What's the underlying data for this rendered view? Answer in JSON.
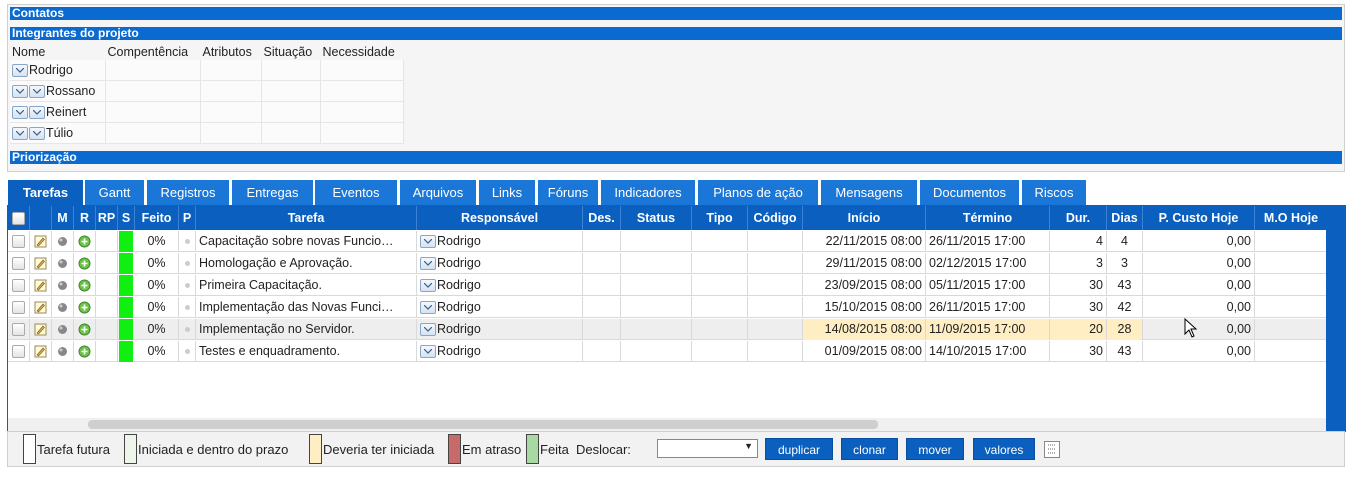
{
  "sections": {
    "contatos": "Contatos",
    "integrantes": "Integrantes do projeto",
    "priorizacao": "Priorização"
  },
  "members": {
    "headers": [
      "Nome",
      "Compentência",
      "Atributos",
      "Situação",
      "Necessidade"
    ],
    "rows": [
      {
        "name": "Rodrigo",
        "arrows": 1
      },
      {
        "name": "Rossano",
        "arrows": 2
      },
      {
        "name": "Reinert",
        "arrows": 2
      },
      {
        "name": "Túlio",
        "arrows": 2
      }
    ]
  },
  "tabs": [
    "Tarefas",
    "Gantt",
    "Registros",
    "Entregas",
    "Eventos",
    "Arquivos",
    "Links",
    "Fóruns",
    "Indicadores",
    "Planos de ação",
    "Mensagens",
    "Documentos",
    "Riscos"
  ],
  "active_tab": "Tarefas",
  "grid": {
    "headers": [
      "",
      "",
      "M",
      "R",
      "RP",
      "S",
      "Feito",
      "P",
      "Tarefa",
      "Responsável",
      "Des.",
      "Status",
      "Tipo",
      "Código",
      "Início",
      "Término",
      "Dur.",
      "Dias",
      "P. Custo Hoje",
      "M.O Hoje"
    ],
    "rows": [
      {
        "feito": "0%",
        "tarefa": "Capacitação sobre novas Funcio…",
        "resp": "Rodrigo",
        "inicio": "22/11/2015 08:00",
        "termino": "26/11/2015 17:00",
        "dur": "4",
        "dias": "4",
        "custo": "0,00"
      },
      {
        "feito": "0%",
        "tarefa": "Homologação e Aprovação.",
        "resp": "Rodrigo",
        "inicio": "29/11/2015 08:00",
        "termino": "02/12/2015 17:00",
        "dur": "3",
        "dias": "3",
        "custo": "0,00"
      },
      {
        "feito": "0%",
        "tarefa": "Primeira Capacitação.",
        "resp": "Rodrigo",
        "inicio": "23/09/2015 08:00",
        "termino": "05/11/2015 17:00",
        "dur": "30",
        "dias": "43",
        "custo": "0,00"
      },
      {
        "feito": "0%",
        "tarefa": "Implementação das Novas Funci…",
        "resp": "Rodrigo",
        "inicio": "15/10/2015 08:00",
        "termino": "26/11/2015 17:00",
        "dur": "30",
        "dias": "42",
        "custo": "0,00"
      },
      {
        "feito": "0%",
        "tarefa": "Implementação no Servidor.",
        "resp": "Rodrigo",
        "inicio": "14/08/2015 08:00",
        "termino": "11/09/2015 17:00",
        "dur": "20",
        "dias": "28",
        "custo": "0,00"
      },
      {
        "feito": "0%",
        "tarefa": "Testes e enquadramento.",
        "resp": "Rodrigo",
        "inicio": "01/09/2015 08:00",
        "termino": "14/10/2015 17:00",
        "dur": "30",
        "dias": "43",
        "custo": "0,00"
      }
    ]
  },
  "legend": [
    {
      "label": "Tarefa futura",
      "color": "#ffffff"
    },
    {
      "label": "Iniciada e dentro do prazo",
      "color": "#eef5ea"
    },
    {
      "label": "Deveria ter iniciada",
      "color": "#ffeec4"
    },
    {
      "label": "Em atraso",
      "color": "#c96a6a"
    },
    {
      "label": "Feita",
      "color": "#a9d9a2"
    }
  ],
  "deslocar_label": "Deslocar:",
  "buttons": {
    "duplicar": "duplicar",
    "clonar": "clonar",
    "mover": "mover",
    "valores": "valores"
  },
  "colors": {
    "header_blue": "#0a5fbf",
    "progress_green": "#11ee11",
    "late_highlight": "#ffeec4"
  }
}
